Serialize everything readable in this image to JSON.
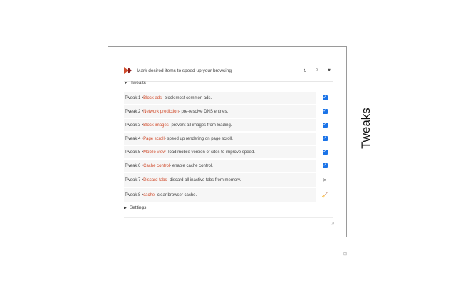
{
  "header": {
    "text": "Mark desired items to speed up your browsing",
    "buttons": {
      "refresh": "↻",
      "help": "?",
      "favorite": "♥"
    }
  },
  "sections": {
    "tweaks_label": "Tweaks",
    "settings_label": "Settings",
    "tri_open": "▼",
    "tri_closed": "▶"
  },
  "tweaks": [
    {
      "prefix": "Tweak 1 • ",
      "name": "Block ads",
      "desc": " - block most common ads.",
      "control": "checkbox",
      "checked": true
    },
    {
      "prefix": "Tweak 2 • ",
      "name": "Network prediction",
      "desc": " - pre-resolve DNS entries.",
      "control": "checkbox",
      "checked": true
    },
    {
      "prefix": "Tweak 3 • ",
      "name": "Block images",
      "desc": " - prevent all images from loading.",
      "control": "checkbox",
      "checked": true
    },
    {
      "prefix": "Tweak 4 • ",
      "name": "Page scroll",
      "desc": " - speed up rendering on page scroll.",
      "control": "checkbox",
      "checked": true
    },
    {
      "prefix": "Tweak 5 • ",
      "name": "Mobile view",
      "desc": " - load mobile version of sites to improve speed.",
      "control": "checkbox",
      "checked": true
    },
    {
      "prefix": "Tweak 6 • ",
      "name": "Cache control",
      "desc": " - enable cache control.",
      "control": "checkbox",
      "checked": true
    },
    {
      "prefix": "Tweak 7 • ",
      "name": "Discard tabs",
      "desc": " - discard all inactive tabs from memory.",
      "control": "close",
      "glyph": "✕"
    },
    {
      "prefix": "Tweak 8 • ",
      "name": "cache",
      "desc": " - clear browser cache.",
      "control": "broom",
      "glyph": "🧹"
    }
  ],
  "checkmark": "✓",
  "footer_icon": "⊡",
  "side_title": "Tweaks",
  "ghost_icon": "⊡",
  "colors": {
    "accent": "#1a73e8",
    "tweak_name": "#d04a2a",
    "logo": "#d04a2a"
  }
}
